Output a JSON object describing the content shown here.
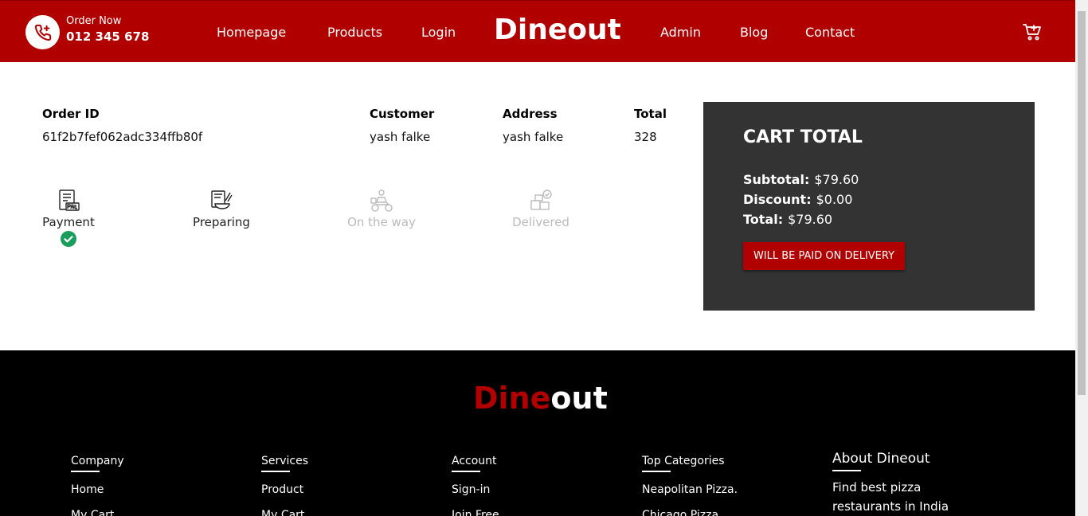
{
  "header": {
    "order_now": "Order Now",
    "phone": "012 345 678",
    "brand": "Dineout",
    "nav_left": [
      "Homepage",
      "Products",
      "Login"
    ],
    "nav_right": [
      "Admin",
      "Blog",
      "Contact"
    ]
  },
  "order": {
    "headers": {
      "id": "Order ID",
      "customer": "Customer",
      "address": "Address",
      "total": "Total"
    },
    "values": {
      "id": "61f2b7fef062adc334ffb80f",
      "customer": "yash falke",
      "address": "yash falke",
      "total": "328"
    }
  },
  "steps": [
    {
      "label": "Payment",
      "icon": "paid-receipt-icon",
      "state": "done"
    },
    {
      "label": "Preparing",
      "icon": "cooking-icon",
      "state": "active"
    },
    {
      "label": "On the way",
      "icon": "delivery-scooter-icon",
      "state": "pending"
    },
    {
      "label": "Delivered",
      "icon": "delivered-box-icon",
      "state": "pending"
    }
  ],
  "cart": {
    "title": "CART TOTAL",
    "subtotal_label": "Subtotal:",
    "subtotal": "$79.60",
    "discount_label": "Discount:",
    "discount": "$0.00",
    "total_label": "Total:",
    "total": "$79.60",
    "button": "WILL BE PAID ON DELIVERY"
  },
  "footer": {
    "brand_red": "Dine",
    "brand_white": "out",
    "columns": [
      {
        "title": "Company",
        "items": [
          "Home",
          "My Cart"
        ]
      },
      {
        "title": "Services",
        "items": [
          "Product",
          "My Cart"
        ]
      },
      {
        "title": "Account",
        "items": [
          "Sign-in",
          "Join Free"
        ]
      },
      {
        "title": "Top Categories",
        "items": [
          "Neapolitan Pizza.",
          "Chicago Pizza."
        ]
      }
    ],
    "about_title": "About Dineout",
    "about_text": "Find best pizza restaurants in India"
  },
  "colors": {
    "brand_red": "#b00000",
    "panel_dark": "#333333",
    "footer_bg": "#000000",
    "check_green": "#1a9e5c"
  }
}
